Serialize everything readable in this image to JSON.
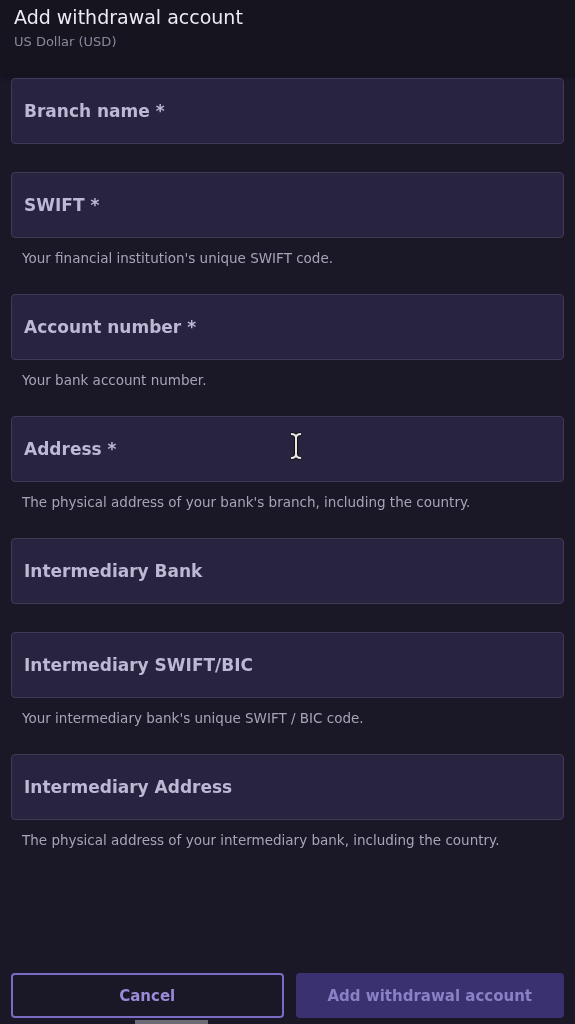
{
  "header": {
    "title": "Add withdrawal account",
    "subtitle": "US Dollar (USD)"
  },
  "fields": [
    {
      "placeholder": "Branch name *"
    },
    {
      "placeholder": "SWIFT *",
      "hint": "Your financial institution's unique SWIFT code."
    },
    {
      "placeholder": "Account number *",
      "hint": "Your bank account number."
    },
    {
      "placeholder": "Address *",
      "hint": "The physical address of your bank's branch, including the country."
    },
    {
      "placeholder": "Intermediary Bank"
    },
    {
      "placeholder": "Intermediary SWIFT/BIC",
      "hint": "Your intermediary bank's unique SWIFT / BIC code."
    },
    {
      "placeholder": "Intermediary Address",
      "hint": "The physical address of your intermediary bank, including the country."
    }
  ],
  "buttons": [
    {
      "label": "Cancel",
      "kind": "secondary",
      "disabled": false
    },
    {
      "label": "Add withdrawal account",
      "kind": "primary",
      "disabled": true
    }
  ]
}
